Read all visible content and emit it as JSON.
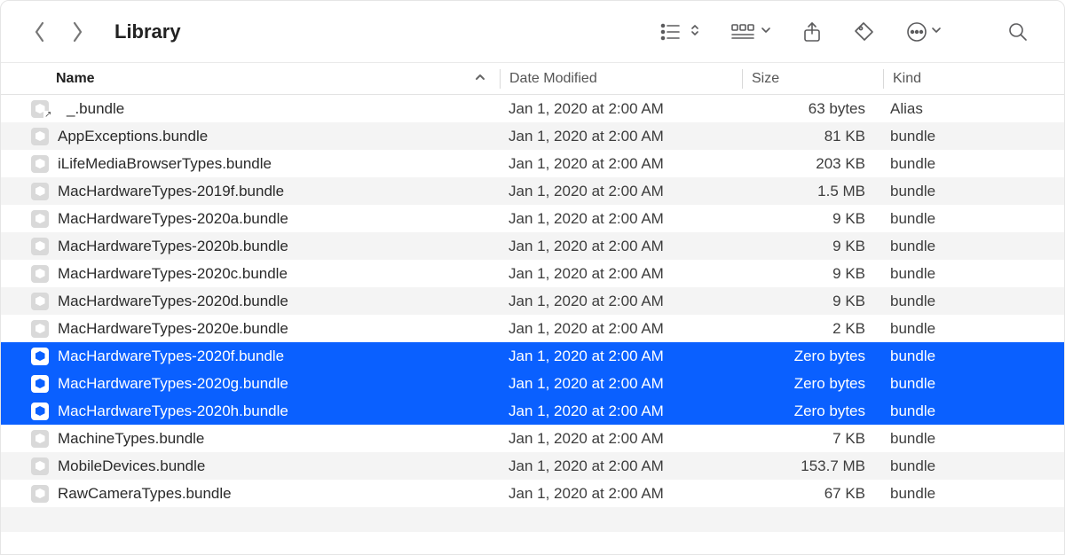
{
  "window": {
    "title": "Library"
  },
  "columns": {
    "name": "Name",
    "date": "Date Modified",
    "size": "Size",
    "kind": "Kind"
  },
  "rows": [
    {
      "name": "_.bundle",
      "date": "Jan 1, 2020 at 2:00 AM",
      "size": "63 bytes",
      "kind": "Alias",
      "alias": true,
      "selected": false
    },
    {
      "name": "AppExceptions.bundle",
      "date": "Jan 1, 2020 at 2:00 AM",
      "size": "81 KB",
      "kind": "bundle",
      "alias": false,
      "selected": false
    },
    {
      "name": "iLifeMediaBrowserTypes.bundle",
      "date": "Jan 1, 2020 at 2:00 AM",
      "size": "203 KB",
      "kind": "bundle",
      "alias": false,
      "selected": false
    },
    {
      "name": "MacHardwareTypes-2019f.bundle",
      "date": "Jan 1, 2020 at 2:00 AM",
      "size": "1.5 MB",
      "kind": "bundle",
      "alias": false,
      "selected": false
    },
    {
      "name": "MacHardwareTypes-2020a.bundle",
      "date": "Jan 1, 2020 at 2:00 AM",
      "size": "9 KB",
      "kind": "bundle",
      "alias": false,
      "selected": false
    },
    {
      "name": "MacHardwareTypes-2020b.bundle",
      "date": "Jan 1, 2020 at 2:00 AM",
      "size": "9 KB",
      "kind": "bundle",
      "alias": false,
      "selected": false
    },
    {
      "name": "MacHardwareTypes-2020c.bundle",
      "date": "Jan 1, 2020 at 2:00 AM",
      "size": "9 KB",
      "kind": "bundle",
      "alias": false,
      "selected": false
    },
    {
      "name": "MacHardwareTypes-2020d.bundle",
      "date": "Jan 1, 2020 at 2:00 AM",
      "size": "9 KB",
      "kind": "bundle",
      "alias": false,
      "selected": false
    },
    {
      "name": "MacHardwareTypes-2020e.bundle",
      "date": "Jan 1, 2020 at 2:00 AM",
      "size": "2 KB",
      "kind": "bundle",
      "alias": false,
      "selected": false
    },
    {
      "name": "MacHardwareTypes-2020f.bundle",
      "date": "Jan 1, 2020 at 2:00 AM",
      "size": "Zero bytes",
      "kind": "bundle",
      "alias": false,
      "selected": true
    },
    {
      "name": "MacHardwareTypes-2020g.bundle",
      "date": "Jan 1, 2020 at 2:00 AM",
      "size": "Zero bytes",
      "kind": "bundle",
      "alias": false,
      "selected": true
    },
    {
      "name": "MacHardwareTypes-2020h.bundle",
      "date": "Jan 1, 2020 at 2:00 AM",
      "size": "Zero bytes",
      "kind": "bundle",
      "alias": false,
      "selected": true
    },
    {
      "name": "MachineTypes.bundle",
      "date": "Jan 1, 2020 at 2:00 AM",
      "size": "7 KB",
      "kind": "bundle",
      "alias": false,
      "selected": false
    },
    {
      "name": "MobileDevices.bundle",
      "date": "Jan 1, 2020 at 2:00 AM",
      "size": "153.7 MB",
      "kind": "bundle",
      "alias": false,
      "selected": false
    },
    {
      "name": "RawCameraTypes.bundle",
      "date": "Jan 1, 2020 at 2:00 AM",
      "size": "67 KB",
      "kind": "bundle",
      "alias": false,
      "selected": false
    }
  ]
}
